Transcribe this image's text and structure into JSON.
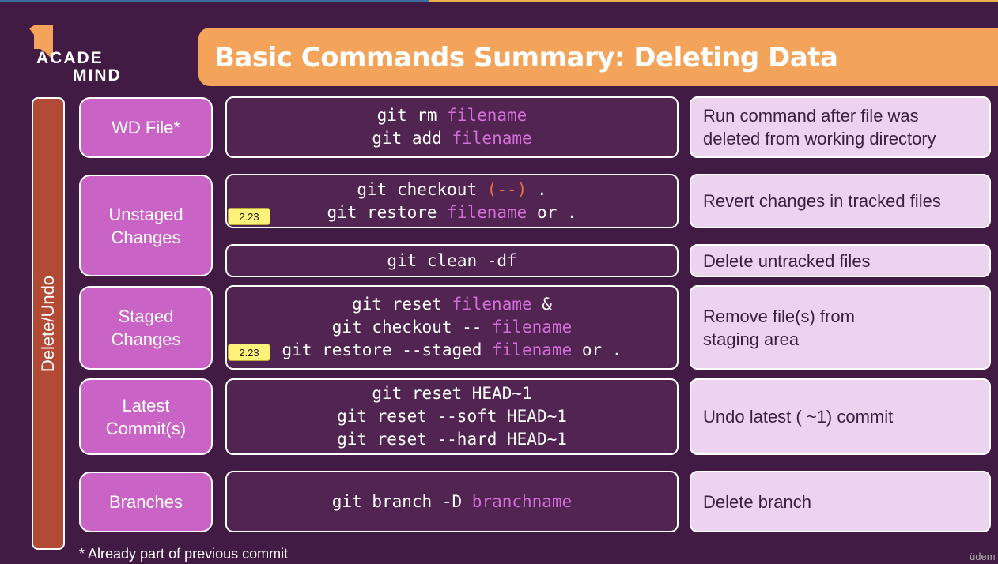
{
  "logo": {
    "line1": "ACADE",
    "line2": "MIND"
  },
  "title": "Basic Commands Summary: Deleting Data",
  "side_label": "Delete/Undo",
  "rows": [
    {
      "category": "WD File*",
      "commands": [
        [
          {
            "t": "git rm "
          },
          {
            "t": "filename",
            "c": "kw"
          }
        ],
        [
          {
            "t": "git add "
          },
          {
            "t": "filename",
            "c": "kw"
          }
        ]
      ],
      "description": "Run command after file was\ndeleted from working directory"
    },
    {
      "category": "Unstaged\nChanges",
      "badge": "2.23",
      "commands": [
        [
          {
            "t": "git checkout "
          },
          {
            "t": "(--)",
            "c": "pn"
          },
          {
            "t": " ."
          }
        ],
        [
          {
            "t": "git restore "
          },
          {
            "t": "filename",
            "c": "kw"
          },
          {
            "t": " or ."
          }
        ]
      ],
      "description": "Revert changes in tracked files"
    },
    {
      "commands": [
        [
          {
            "t": "git clean -df"
          }
        ]
      ],
      "description": "Delete untracked files"
    },
    {
      "category": "Staged\nChanges",
      "badge": "2.23",
      "commands": [
        [
          {
            "t": "git reset "
          },
          {
            "t": "filename",
            "c": "kw"
          },
          {
            "t": " &"
          }
        ],
        [
          {
            "t": "git checkout -- "
          },
          {
            "t": "filename",
            "c": "kw"
          }
        ],
        [
          {
            "t": "git restore --staged "
          },
          {
            "t": "filename",
            "c": "kw"
          },
          {
            "t": " or ."
          }
        ]
      ],
      "description": "Remove file(s) from\nstaging area"
    },
    {
      "category": "Latest\nCommit(s)",
      "commands": [
        [
          {
            "t": "git reset HEAD~1"
          }
        ],
        [
          {
            "t": "git reset --soft HEAD~1"
          }
        ],
        [
          {
            "t": "git reset --hard HEAD~1"
          }
        ]
      ],
      "description": "Undo latest ( ~1) commit"
    },
    {
      "category": "Branches",
      "commands": [
        [
          {
            "t": "git branch -D "
          },
          {
            "t": "branchname",
            "c": "kw"
          }
        ]
      ],
      "description": "Delete branch"
    }
  ],
  "footnote": "* Already part of previous commit",
  "watermark": "üdem"
}
